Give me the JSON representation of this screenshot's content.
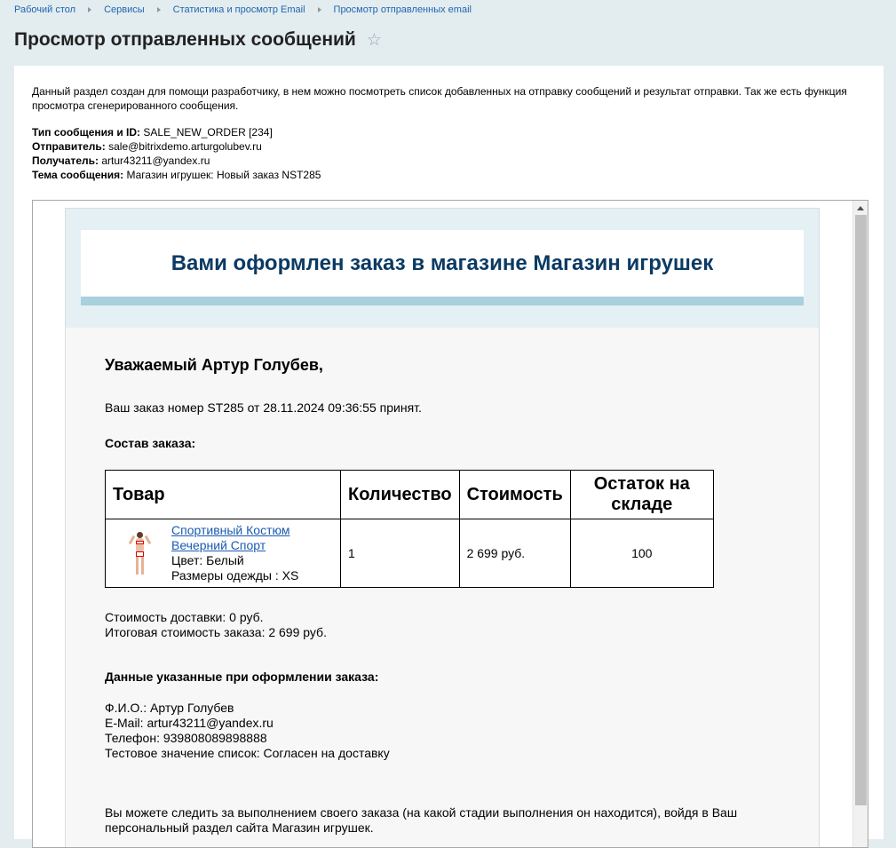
{
  "breadcrumbs": [
    "Рабочий стол",
    "Сервисы",
    "Статистика и просмотр Email",
    "Просмотр отправленных email"
  ],
  "page": {
    "title": "Просмотр отправленных сообщений",
    "star_icon": "star-outline-icon"
  },
  "intro": "Данный раздел создан для помощи разработчику, в нем можно посмотреть список добавленных на отправку сообщений и результат отправки. Так же есть функция просмотра сгенерированного сообщения.",
  "meta": {
    "type_label": "Тип сообщения и ID:",
    "type_value": "SALE_NEW_ORDER [234]",
    "sender_label": "Отправитель:",
    "sender_value": "sale@bitrixdemo.arturgolubev.ru",
    "recipient_label": "Получатель:",
    "recipient_value": "artur43211@yandex.ru",
    "subject_label": "Тема сообщения:",
    "subject_value": "Магазин игрушек: Новый заказ NST285"
  },
  "email": {
    "heading": "Вами оформлен заказ в магазине Магазин игрушек",
    "greeting": "Уважаемый Артур Голубев,",
    "order_message": "Ваш заказ номер ST285 от 28.11.2024 09:36:55 принят.",
    "composition_title": "Состав заказа:",
    "table": {
      "headers": [
        "Товар",
        "Количество",
        "Стоимость",
        "Остаток на складе"
      ],
      "row": {
        "product_name_line1": "Спортивный Костюм",
        "product_name_line2": "Вечерний Спорт",
        "color": "Цвет: Белый",
        "size": "Размеры одежды : XS",
        "quantity": "1",
        "price": "2 699 руб.",
        "stock": "100"
      }
    },
    "delivery_cost": "Стоимость доставки: 0 руб.",
    "total_cost": "Итоговая стоимость заказа: 2 699 руб.",
    "data_title": "Данные указанные при оформлении заказа:",
    "customer": {
      "name": "Ф.И.О.: Артур Голубев",
      "email": "E-Mail: artur43211@yandex.ru",
      "phone": "Телефон: 939808089898888",
      "test_value": "Тестовое значение список: Согласен на доставку"
    },
    "tracking": "Вы можете следить за выполнением своего заказа (на какой стадии выполнения он находится), войдя в Ваш персональный раздел сайта Магазин игрушек."
  }
}
